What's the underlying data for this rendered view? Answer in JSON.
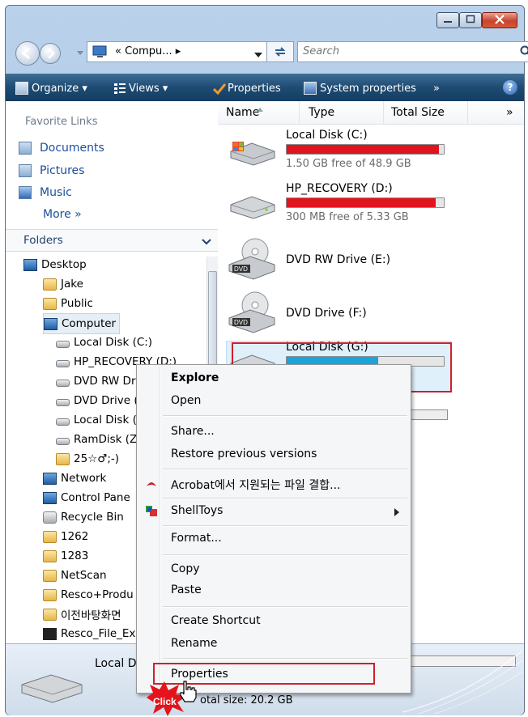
{
  "address": {
    "path_text": "« Compu... ▸",
    "search_placeholder": "Search"
  },
  "toolbar": {
    "organize_label": "Organize ▾",
    "views_label": "Views ▾",
    "properties_label": "Properties",
    "system_properties_label": "System properties",
    "more_label": "»"
  },
  "nav": {
    "favorites_header": "Favorite Links",
    "favorites": [
      {
        "label": "Documents"
      },
      {
        "label": "Pictures"
      },
      {
        "label": "Music"
      }
    ],
    "more_label": "More »",
    "folders_header": "Folders",
    "tree": [
      {
        "label": "Desktop"
      },
      {
        "label": "Jake"
      },
      {
        "label": "Public"
      },
      {
        "label": "Computer"
      },
      {
        "label": "Local Disk (C:)"
      },
      {
        "label": "HP_RECOVERY (D:)"
      },
      {
        "label": "DVD RW Dr"
      },
      {
        "label": "DVD Drive ("
      },
      {
        "label": "Local Disk ("
      },
      {
        "label": "RamDisk (Z"
      },
      {
        "label": "25☆♂;-)"
      },
      {
        "label": "Network"
      },
      {
        "label": "Control Pane"
      },
      {
        "label": "Recycle Bin"
      },
      {
        "label": "1262"
      },
      {
        "label": "1283"
      },
      {
        "label": "NetScan"
      },
      {
        "label": "Resco+Produ"
      },
      {
        "label": "이전바탕화면"
      },
      {
        "label": "Resco_File_Ex"
      }
    ]
  },
  "columns": {
    "name": "Name",
    "type": "Type",
    "total_size": "Total Size",
    "more": "»"
  },
  "drives": [
    {
      "name": "Local Disk (C:)",
      "free": "1.50 GB free of 48.9 GB",
      "used_fraction": 0.97,
      "color": "#e0141e"
    },
    {
      "name": "HP_RECOVERY (D:)",
      "free": "300 MB free of 5.33 GB",
      "used_fraction": 0.95,
      "color": "#e0141e"
    },
    {
      "name": "DVD RW Drive (E:)"
    },
    {
      "name": "DVD Drive (F:)"
    },
    {
      "name": "Local Disk (G:)",
      "used_fraction": 0.58,
      "color": "#1aa4dc"
    }
  ],
  "context_menu": {
    "explore": "Explore",
    "open": "Open",
    "share": "Share...",
    "restore": "Restore previous versions",
    "acrobat": "Acrobat에서 지원되는 파일 결합...",
    "shelltoys": "ShellToys",
    "format": "Format...",
    "copy": "Copy",
    "paste": "Paste",
    "create_shortcut": "Create Shortcut",
    "rename": "Rename",
    "properties": "Properties"
  },
  "details": {
    "name": "Local D",
    "total_size": "otal size: 20.2 GB"
  },
  "click_badge": "Click",
  "colors": {
    "highlight_red": "#d0202a",
    "toolbar_blue": "#1e4b73",
    "link_blue": "#1c4e9c"
  }
}
